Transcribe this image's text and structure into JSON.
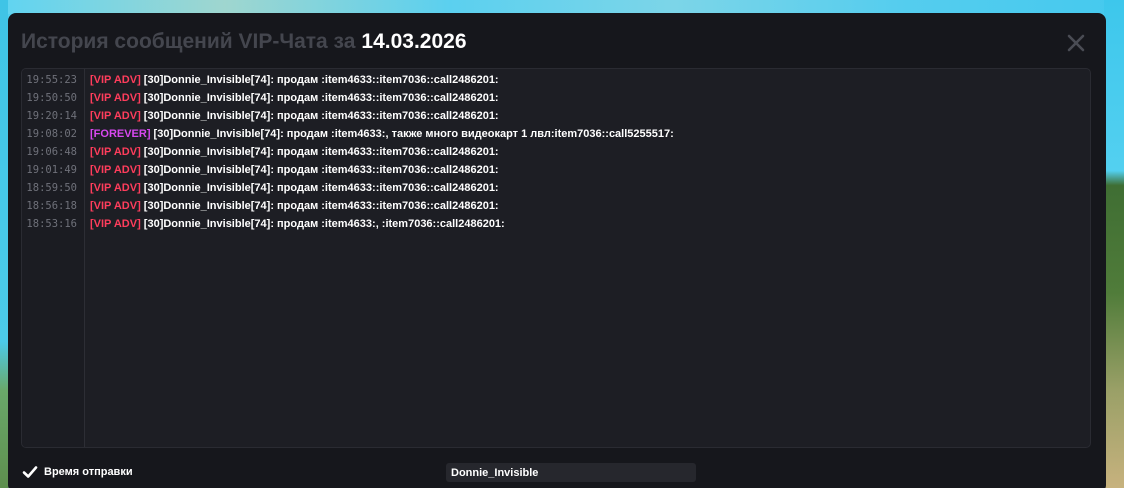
{
  "window": {
    "title_prefix": "История сообщений VIP-Чата за",
    "title_date": "14.03.2026",
    "close_icon": "close-icon"
  },
  "log": {
    "rows": [
      {
        "time": "19:55:23",
        "tag": "[VIP ADV]",
        "tag_type": "vip",
        "text": " [30]Donnie_Invisible[74]: продам :item4633::item7036::call2486201:"
      },
      {
        "time": "19:50:50",
        "tag": "[VIP ADV]",
        "tag_type": "vip",
        "text": " [30]Donnie_Invisible[74]: продам :item4633::item7036::call2486201:"
      },
      {
        "time": "19:20:14",
        "tag": "[VIP ADV]",
        "tag_type": "vip",
        "text": " [30]Donnie_Invisible[74]: продам :item4633::item7036::call2486201:"
      },
      {
        "time": "19:08:02",
        "tag": "[FOREVER]",
        "tag_type": "forever",
        "text": " [30]Donnie_Invisible[74]: продам :item4633:, также много видеокарт 1 лвл:item7036::call5255517:"
      },
      {
        "time": "19:06:48",
        "tag": "[VIP ADV]",
        "tag_type": "vip",
        "text": " [30]Donnie_Invisible[74]: продам :item4633::item7036::call2486201:"
      },
      {
        "time": "19:01:49",
        "tag": "[VIP ADV]",
        "tag_type": "vip",
        "text": " [30]Donnie_Invisible[74]: продам :item4633::item7036::call2486201:"
      },
      {
        "time": "18:59:50",
        "tag": "[VIP ADV]",
        "tag_type": "vip",
        "text": " [30]Donnie_Invisible[74]: продам :item4633::item7036::call2486201:"
      },
      {
        "time": "18:56:18",
        "tag": "[VIP ADV]",
        "tag_type": "vip",
        "text": " [30]Donnie_Invisible[74]: продам :item4633::item7036::call2486201:"
      },
      {
        "time": "18:53:16",
        "tag": "[VIP ADV]",
        "tag_type": "vip",
        "text": " [30]Donnie_Invisible[74]: продам :item4633:, :item7036::call2486201:"
      }
    ]
  },
  "footer": {
    "checkbox_label": "Время отправки",
    "checkbox_checked": true,
    "search_value": "Donnie_Invisible"
  },
  "colors": {
    "vip_tag": "#ff3d5c",
    "forever_tag": "#d848f0",
    "panel_bg": "#16171c"
  }
}
